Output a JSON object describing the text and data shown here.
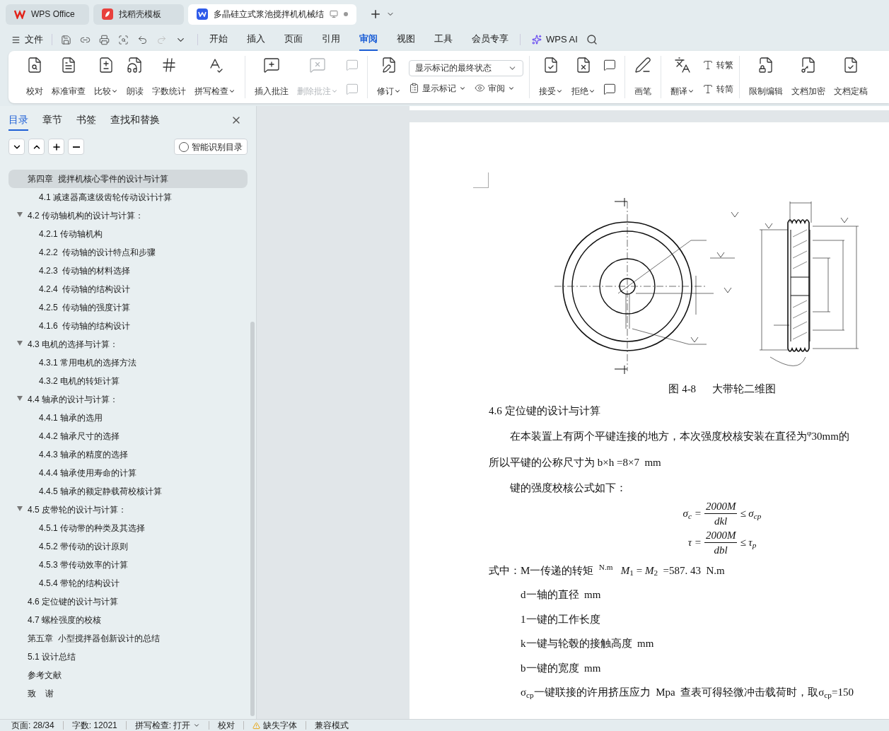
{
  "tabs": [
    {
      "label": "WPS Office",
      "kind": "home",
      "selected": false
    },
    {
      "label": "找稻壳模板",
      "kind": "template",
      "selected": false
    },
    {
      "label": "多晶硅立式浆池搅拌机机械结",
      "kind": "doc",
      "selected": true
    }
  ],
  "menu": {
    "file": "文件",
    "tabs": [
      {
        "label": "开始",
        "selected": false
      },
      {
        "label": "插入",
        "selected": false
      },
      {
        "label": "页面",
        "selected": false
      },
      {
        "label": "引用",
        "selected": false
      },
      {
        "label": "审阅",
        "selected": true
      },
      {
        "label": "视图",
        "selected": false
      },
      {
        "label": "工具",
        "selected": false
      },
      {
        "label": "会员专享",
        "selected": false
      }
    ],
    "ai": "WPS AI"
  },
  "ribbon": [
    {
      "items": [
        {
          "kind": "large",
          "label": "校对",
          "dropdown": false,
          "disabled": false
        },
        {
          "kind": "large",
          "label": "标准审查",
          "dropdown": false,
          "disabled": false
        },
        {
          "kind": "large",
          "label": "比较",
          "dropdown": true,
          "disabled": false
        },
        {
          "kind": "large",
          "label": "朗读",
          "dropdown": false,
          "disabled": false
        },
        {
          "kind": "large",
          "label": "字数统计",
          "dropdown": false,
          "disabled": false
        },
        {
          "kind": "large",
          "label": "拼写检查",
          "dropdown": true,
          "disabled": false
        }
      ]
    },
    {
      "items": [
        {
          "kind": "large",
          "label": "插入批注",
          "dropdown": false,
          "disabled": false
        },
        {
          "kind": "large",
          "label": "删除批注",
          "dropdown": true,
          "disabled": true
        },
        {
          "kind": "stack",
          "disabled": true
        }
      ]
    },
    {
      "items": [
        {
          "kind": "large",
          "label": "修订",
          "dropdown": true,
          "disabled": false
        },
        {
          "kind": "select",
          "value": "显示标记的最终状态",
          "buttons": [
            {
              "label": "显示标记"
            },
            {
              "label": "审阅"
            }
          ]
        }
      ]
    },
    {
      "items": [
        {
          "kind": "large",
          "label": "接受",
          "dropdown": true,
          "disabled": false
        },
        {
          "kind": "large",
          "label": "拒绝",
          "dropdown": true,
          "disabled": false
        },
        {
          "kind": "stack",
          "disabled": false
        }
      ]
    },
    {
      "items": [
        {
          "kind": "large",
          "label": "画笔",
          "dropdown": false,
          "disabled": false
        }
      ]
    },
    {
      "items": [
        {
          "kind": "large",
          "label": "翻译",
          "dropdown": true,
          "disabled": false
        },
        {
          "kind": "small",
          "buttons": [
            {
              "label": "转繁"
            },
            {
              "label": "转简"
            }
          ]
        }
      ]
    },
    {
      "items": [
        {
          "kind": "large",
          "label": "限制编辑",
          "dropdown": false,
          "disabled": false
        },
        {
          "kind": "large",
          "label": "文档加密",
          "dropdown": false,
          "disabled": false
        },
        {
          "kind": "large",
          "label": "文档定稿",
          "dropdown": false,
          "disabled": false
        }
      ]
    }
  ],
  "sidebar": {
    "tabs": [
      {
        "label": "目录",
        "selected": true
      },
      {
        "label": "章节",
        "selected": false
      },
      {
        "label": "书签",
        "selected": false
      },
      {
        "label": "查找和替换",
        "selected": false
      }
    ],
    "smart_button": "智能识别目录",
    "toc": [
      {
        "label": "第四章  搅拌机核心零件的设计与计算",
        "selected": true,
        "children": [
          {
            "label": "4.1 减速器高速级齿轮传动设计计算",
            "selected": false
          }
        ]
      },
      {
        "label": "4.2 传动轴机构的设计与计算：",
        "selected": false,
        "expanded": true,
        "children": [
          {
            "label": "4.2.1 传动轴机构",
            "selected": false
          },
          {
            "label": "4.2.2  传动轴的设计特点和步骤",
            "selected": false
          },
          {
            "label": "4.2.3  传动轴的材料选择",
            "selected": false
          },
          {
            "label": "4.2.4  传动轴的结构设计",
            "selected": false
          },
          {
            "label": "4.2.5  传动轴的强度计算",
            "selected": false
          },
          {
            "label": "4.1.6  传动轴的结构设计",
            "selected": false
          }
        ]
      },
      {
        "label": "4.3 电机的选择与计算：",
        "selected": false,
        "expanded": true,
        "children": [
          {
            "label": "4.3.1 常用电机的选择方法",
            "selected": false
          },
          {
            "label": "4.3.2 电机的转矩计算",
            "selected": false
          }
        ]
      },
      {
        "label": "4.4 轴承的设计与计算：",
        "selected": false,
        "expanded": true,
        "children": [
          {
            "label": "4.4.1 轴承的选用",
            "selected": false
          },
          {
            "label": "4.4.2 轴承尺寸的选择",
            "selected": false
          },
          {
            "label": "4.4.3 轴承的精度的选择",
            "selected": false
          },
          {
            "label": "4.4.4 轴承使用寿命的计算",
            "selected": false
          },
          {
            "label": "4.4.5 轴承的额定静载荷校核计算",
            "selected": false
          }
        ]
      },
      {
        "label": "4.5 皮带轮的设计与计算：",
        "selected": false,
        "expanded": true,
        "children": [
          {
            "label": "4.5.1 传动带的种类及其选择",
            "selected": false
          },
          {
            "label": "4.5.2 带传动的设计原则",
            "selected": false
          },
          {
            "label": "4.5.3 带传动效率的计算",
            "selected": false
          },
          {
            "label": "4.5.4 带轮的结构设计",
            "selected": false
          }
        ]
      },
      {
        "label": "4.6 定位键的设计与计算",
        "selected": false
      },
      {
        "label": "4.7 螺栓强度的校核",
        "selected": false
      },
      {
        "label": "第五章  小型搅拌器创新设计的总结",
        "selected": false
      },
      {
        "label": "5.1 设计总结",
        "selected": false
      },
      {
        "label": "参考文献",
        "selected": false
      },
      {
        "label": "致    谢",
        "selected": false
      }
    ]
  },
  "document": {
    "caption": "图 4-8      大带轮二维图",
    "heading": "4.6 定位键的设计与计算",
    "paragraphs": [
      {
        "kind": "indent",
        "text": "在本装置上有两个平键连接的地方，本次强度校核安装在直径为$^{φ}$30mm的"
      },
      {
        "kind": "plain",
        "text": "所以平键的公称尺寸为 b×h =8×7  mm"
      },
      {
        "kind": "indent",
        "text": "键的强度校核公式如下："
      }
    ],
    "formulas": [
      {
        "lhs": "σ$_{c}$ =",
        "numerator": "2000M",
        "denominator": "dkl",
        "rhs": "≤ σ$_{cp}$"
      },
      {
        "lhs": "τ =",
        "numerator": "2000M",
        "denominator": "dbl",
        "rhs": "≤ τ$_{p}$"
      }
    ],
    "where": "式中：M一传递的转矩  $^{N.m}$   *M*$_{1}$ = *M*$_{2}$  =587. 43  N.m",
    "definitions": [
      "d一轴的直径  mm",
      "1一键的工作长度",
      "k一键与轮毂的接触高度  mm",
      "b一键的宽度  mm",
      "σ$_{cp}$一键联接的许用挤压应力  Mpa  查表可得轻微冲击载荷时，取σ$_{cp}$=150"
    ]
  },
  "status_bar": [
    {
      "kind": "text",
      "label": "页面: 28/34"
    },
    {
      "kind": "text",
      "label": "字数: 12021"
    },
    {
      "kind": "dropdown",
      "label": "拼写检查: 打开"
    },
    {
      "kind": "text",
      "label": "校对"
    },
    {
      "kind": "warning",
      "label": "缺失字体"
    },
    {
      "kind": "text",
      "label": "兼容模式"
    }
  ]
}
